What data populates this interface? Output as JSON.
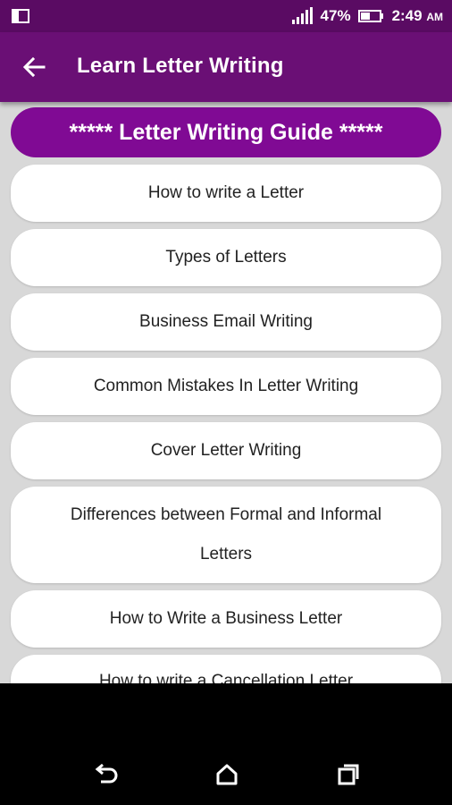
{
  "status": {
    "battery_percent": "47%",
    "time": "2:49",
    "ampm": "AM"
  },
  "app_bar": {
    "title": "Learn Letter Writing"
  },
  "guide_header": "***** Letter Writing Guide *****",
  "menu_items": [
    {
      "label": "How to write a Letter"
    },
    {
      "label": "Types of Letters"
    },
    {
      "label": "Business Email Writing"
    },
    {
      "label": "Common Mistakes In Letter Writing"
    },
    {
      "label": "Cover Letter Writing"
    },
    {
      "label": "Differences between Formal and Informal Letters"
    },
    {
      "label": "How to Write a Business Letter"
    },
    {
      "label": "How to write a Cancellation Letter"
    }
  ],
  "icons": {
    "back": "arrow-left-icon",
    "nav_back": "back-icon",
    "nav_home": "home-icon",
    "nav_recents": "recents-icon"
  },
  "colors": {
    "status_bar": "#5a0b63",
    "app_bar": "#6a0f75",
    "guide_header": "#800a94",
    "background": "#d8d8d8"
  }
}
